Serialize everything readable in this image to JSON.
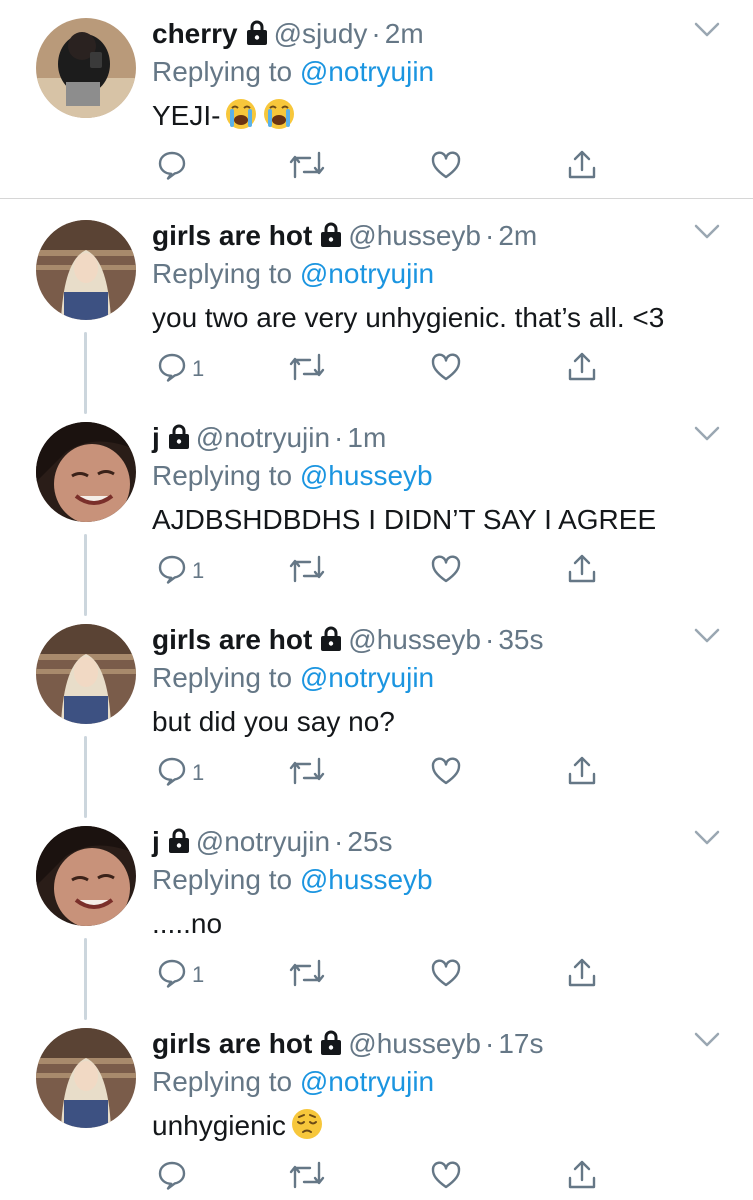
{
  "colors": {
    "text": "#14171a",
    "secondary": "#657786",
    "mention": "#1b95e0",
    "thread_line": "#ccd6dd",
    "divider": "#d6d6d6"
  },
  "tweets": [
    {
      "display_name": "cherry",
      "protected": true,
      "handle": "@sjudy",
      "separator": "·",
      "time": "2m",
      "replying_prefix": "Replying to",
      "replying_to": "@notryujin",
      "text": "YEJI-",
      "emojis": [
        "loudly-crying-face",
        "loudly-crying-face"
      ],
      "reply_count": "",
      "avatar": "avatar-cherry"
    },
    {
      "display_name": "girls are hot",
      "protected": true,
      "handle": "@husseyb",
      "separator": "·",
      "time": "2m",
      "replying_prefix": "Replying to",
      "replying_to": "@notryujin",
      "text": "you two are very unhygienic. that’s all. <3",
      "emojis": [],
      "reply_count": "1",
      "avatar": "avatar-girls-are-hot"
    },
    {
      "display_name": "j",
      "protected": true,
      "handle": "@notryujin",
      "separator": "·",
      "time": "1m",
      "replying_prefix": "Replying to",
      "replying_to": "@husseyb",
      "text": "AJDBSHDBDHS I DIDN’T SAY I AGREE",
      "emojis": [],
      "reply_count": "1",
      "avatar": "avatar-j"
    },
    {
      "display_name": "girls are hot",
      "protected": true,
      "handle": "@husseyb",
      "separator": "·",
      "time": "35s",
      "replying_prefix": "Replying to",
      "replying_to": "@notryujin",
      "text": "but did you say no?",
      "emojis": [],
      "reply_count": "1",
      "avatar": "avatar-girls-are-hot"
    },
    {
      "display_name": "j",
      "protected": true,
      "handle": "@notryujin",
      "separator": "·",
      "time": "25s",
      "replying_prefix": "Replying to",
      "replying_to": "@husseyb",
      "text": ".....no",
      "emojis": [],
      "reply_count": "1",
      "avatar": "avatar-j"
    },
    {
      "display_name": "girls are hot",
      "protected": true,
      "handle": "@husseyb",
      "separator": "·",
      "time": "17s",
      "replying_prefix": "Replying to",
      "replying_to": "@notryujin",
      "text": "unhygienic",
      "emojis": [
        "pensive-face"
      ],
      "reply_count": "",
      "avatar": "avatar-girls-are-hot"
    }
  ],
  "icons": {
    "reply": "reply-icon",
    "retweet": "retweet-icon",
    "like": "like-icon",
    "share": "share-icon",
    "more": "chevron-down-icon",
    "protected": "lock-icon"
  }
}
